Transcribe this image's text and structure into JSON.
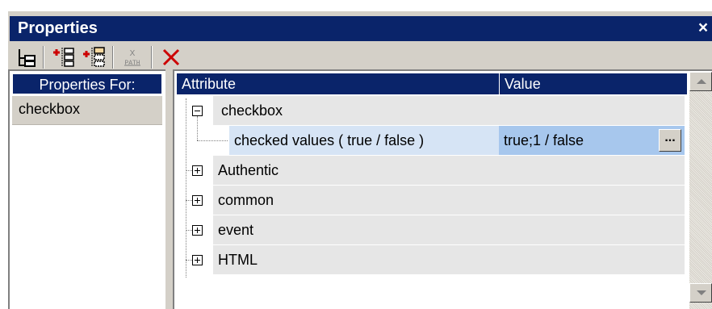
{
  "window": {
    "title": "Properties",
    "close_label": "×"
  },
  "toolbar": {
    "buttons": [
      {
        "name": "tree-view-icon"
      },
      {
        "name": "insert-element-icon"
      },
      {
        "name": "append-element-icon"
      },
      {
        "name": "xpath-icon",
        "label": "X PATH"
      },
      {
        "name": "delete-icon"
      }
    ]
  },
  "left_pane": {
    "header": "Properties For:",
    "items": [
      "checkbox"
    ]
  },
  "grid": {
    "columns": [
      "Attribute",
      "Value"
    ],
    "rows": [
      {
        "label": "checkbox",
        "expanded": true,
        "level": 0,
        "value": ""
      },
      {
        "label": "checked values ( true / false )",
        "level": 1,
        "value": "true;1 / false",
        "selected": true,
        "button": "..."
      },
      {
        "label": "Authentic",
        "expanded": false,
        "level": 0,
        "value": ""
      },
      {
        "label": "common",
        "expanded": false,
        "level": 0,
        "value": ""
      },
      {
        "label": "event",
        "expanded": false,
        "level": 0,
        "value": ""
      },
      {
        "label": "HTML",
        "expanded": false,
        "level": 0,
        "value": ""
      }
    ]
  },
  "colors": {
    "header_bg": "#0a246a",
    "selected_attr_bg": "#d6e4f5",
    "selected_value_bg": "#a7c7ed",
    "row_bg": "#e6e6e6",
    "delete_red": "#cc0000"
  }
}
